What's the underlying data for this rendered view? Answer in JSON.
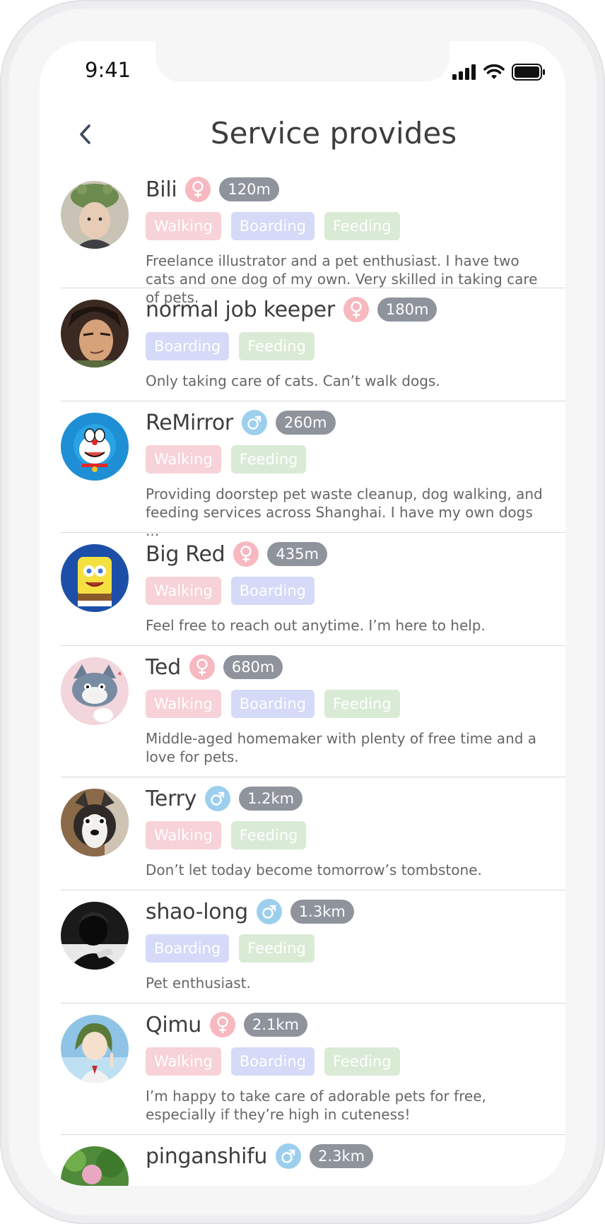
{
  "status_bar": {
    "time": "9:41"
  },
  "header": {
    "title": "Service provides"
  },
  "providers": [
    {
      "name": "Bili",
      "gender": "female",
      "distance": "120m",
      "tags": [
        "Walking",
        "Boarding",
        "Feeding"
      ],
      "description": "Freelance illustrator and a pet enthusiast. I have two cats and one dog of my own. Very skilled in taking care of pets."
    },
    {
      "name": "normal job keeper",
      "gender": "female",
      "distance": "180m",
      "tags": [
        "Boarding",
        "Feeding"
      ],
      "description": "Only taking care of cats. Can’t walk dogs."
    },
    {
      "name": "ReMirror",
      "gender": "male",
      "distance": "260m",
      "tags": [
        "Walking",
        "Feeding"
      ],
      "description": "Providing doorstep pet waste cleanup, dog walking, and feeding services across Shanghai. I have my own dogs ..."
    },
    {
      "name": "Big Red",
      "gender": "female",
      "distance": "435m",
      "tags": [
        "Walking",
        "Boarding"
      ],
      "description": "Feel free to reach out anytime. I’m here to help."
    },
    {
      "name": "Ted",
      "gender": "female",
      "distance": "680m",
      "tags": [
        "Walking",
        "Boarding",
        "Feeding"
      ],
      "description": "Middle-aged homemaker with plenty of free time and a love for pets."
    },
    {
      "name": "Terry",
      "gender": "male",
      "distance": "1.2km",
      "tags": [
        "Walking",
        "Feeding"
      ],
      "description": "Don’t let today become tomorrow’s tombstone."
    },
    {
      "name": "shao-long",
      "gender": "male",
      "distance": "1.3km",
      "tags": [
        "Boarding",
        "Feeding"
      ],
      "description": "Pet enthusiast."
    },
    {
      "name": "Qimu",
      "gender": "female",
      "distance": "2.1km",
      "tags": [
        "Walking",
        "Boarding",
        "Feeding"
      ],
      "description": "I’m happy to take care of adorable pets for free, especially if they’re high in cuteness!"
    },
    {
      "name": "pinganshifu",
      "gender": "male",
      "distance": "2.3km",
      "tags": [],
      "description": ""
    }
  ],
  "colors": {
    "tag_walking": "#f7d2d8",
    "tag_boarding": "#d4daf7",
    "tag_feeding": "#d9ebd5",
    "gender_female": "#f7b8c0",
    "gender_male": "#9ccfee",
    "distance_badge": "#8e939c"
  }
}
